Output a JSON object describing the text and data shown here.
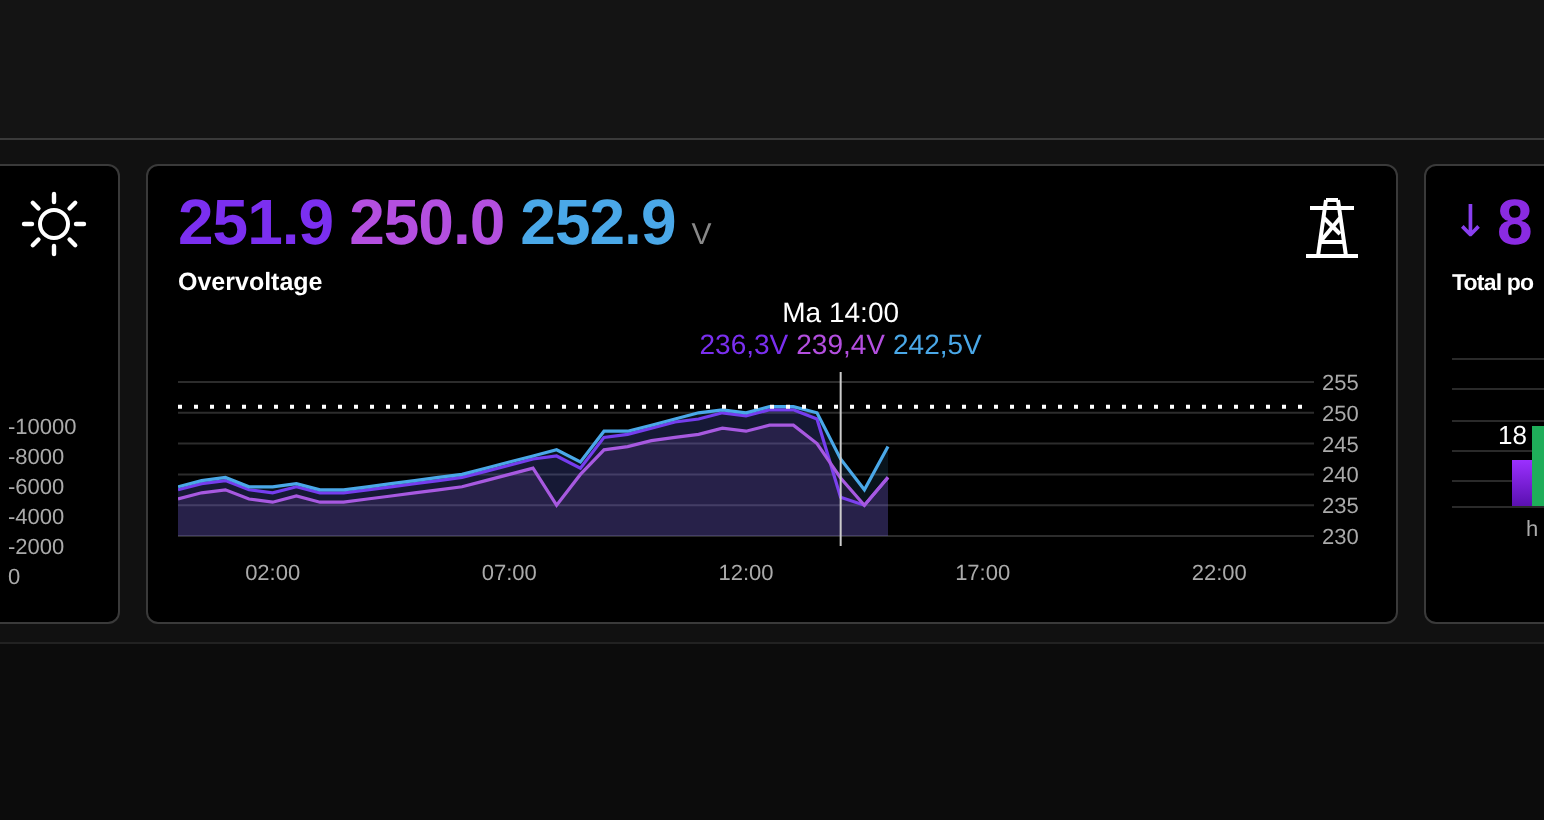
{
  "left_card": {
    "axis_labels": [
      "-10000",
      "-8000",
      "-6000",
      "-4000",
      "-2000",
      "0"
    ]
  },
  "voltage_card": {
    "readings": [
      {
        "value": "251.9",
        "color": "#7b2ff0"
      },
      {
        "value": "250.0",
        "color": "#b44fe0"
      },
      {
        "value": "252.9",
        "color": "#4aa8e8"
      }
    ],
    "unit": "V",
    "title": "Overvoltage",
    "tooltip": {
      "title": "Ma 14:00",
      "values": [
        {
          "text": "236,3V",
          "color": "#7b2ff0"
        },
        {
          "text": "239,4V",
          "color": "#b44fe0"
        },
        {
          "text": "242,5V",
          "color": "#4aa8e8"
        }
      ]
    },
    "chart_data": {
      "type": "area",
      "x": [
        0,
        0.5,
        1,
        1.5,
        2,
        2.5,
        3,
        3.5,
        4,
        4.5,
        5,
        5.5,
        6,
        6.5,
        7,
        7.5,
        8,
        8.5,
        9,
        9.5,
        10,
        10.5,
        11,
        11.5,
        12,
        12.5,
        13,
        13.5,
        14,
        14.5,
        15
      ],
      "xlim": [
        0,
        24
      ],
      "ylim": [
        230,
        255
      ],
      "xticks": [
        {
          "value": 2,
          "label": "02:00"
        },
        {
          "value": 7,
          "label": "07:00"
        },
        {
          "value": 12,
          "label": "12:00"
        },
        {
          "value": 17,
          "label": "17:00"
        },
        {
          "value": 22,
          "label": "22:00"
        }
      ],
      "yticks": [
        230,
        235,
        240,
        245,
        250,
        255
      ],
      "series": [
        {
          "color": "#7b2ff0",
          "values": [
            237.5,
            238.5,
            239,
            237.5,
            237,
            238,
            237,
            237,
            237.5,
            238,
            238.5,
            239,
            239.5,
            240.5,
            241.5,
            242.5,
            243,
            241,
            246,
            246.5,
            247.5,
            248.5,
            249,
            250,
            249.5,
            250.5,
            250.5,
            249,
            236.3,
            235,
            239.5
          ]
        },
        {
          "color": "#b44fe0",
          "values": [
            236,
            237,
            237.5,
            236,
            235.5,
            236.5,
            235.5,
            235.5,
            236,
            236.5,
            237,
            237.5,
            238,
            239,
            240,
            241,
            235,
            240,
            244,
            244.5,
            245.5,
            246,
            246.5,
            247.5,
            247,
            248,
            248,
            245,
            239.4,
            235,
            239.5
          ]
        },
        {
          "color": "#4aa8e8",
          "values": [
            238,
            239,
            239.5,
            238,
            238,
            238.5,
            237.5,
            237.5,
            238,
            238.5,
            239,
            239.5,
            240,
            241,
            242,
            243,
            244,
            242,
            247,
            247,
            248,
            249,
            250,
            250.5,
            250,
            251,
            251,
            250,
            242.5,
            237.5,
            244.5
          ]
        }
      ],
      "grid": true,
      "ref_lines": [
        {
          "axis": "y",
          "value": 251
        },
        {
          "axis": "x",
          "value": 14
        }
      ]
    }
  },
  "power_card": {
    "arrow": "↓",
    "value": "8",
    "title": "Total po",
    "bar_label": "18",
    "axis_label": "h"
  }
}
